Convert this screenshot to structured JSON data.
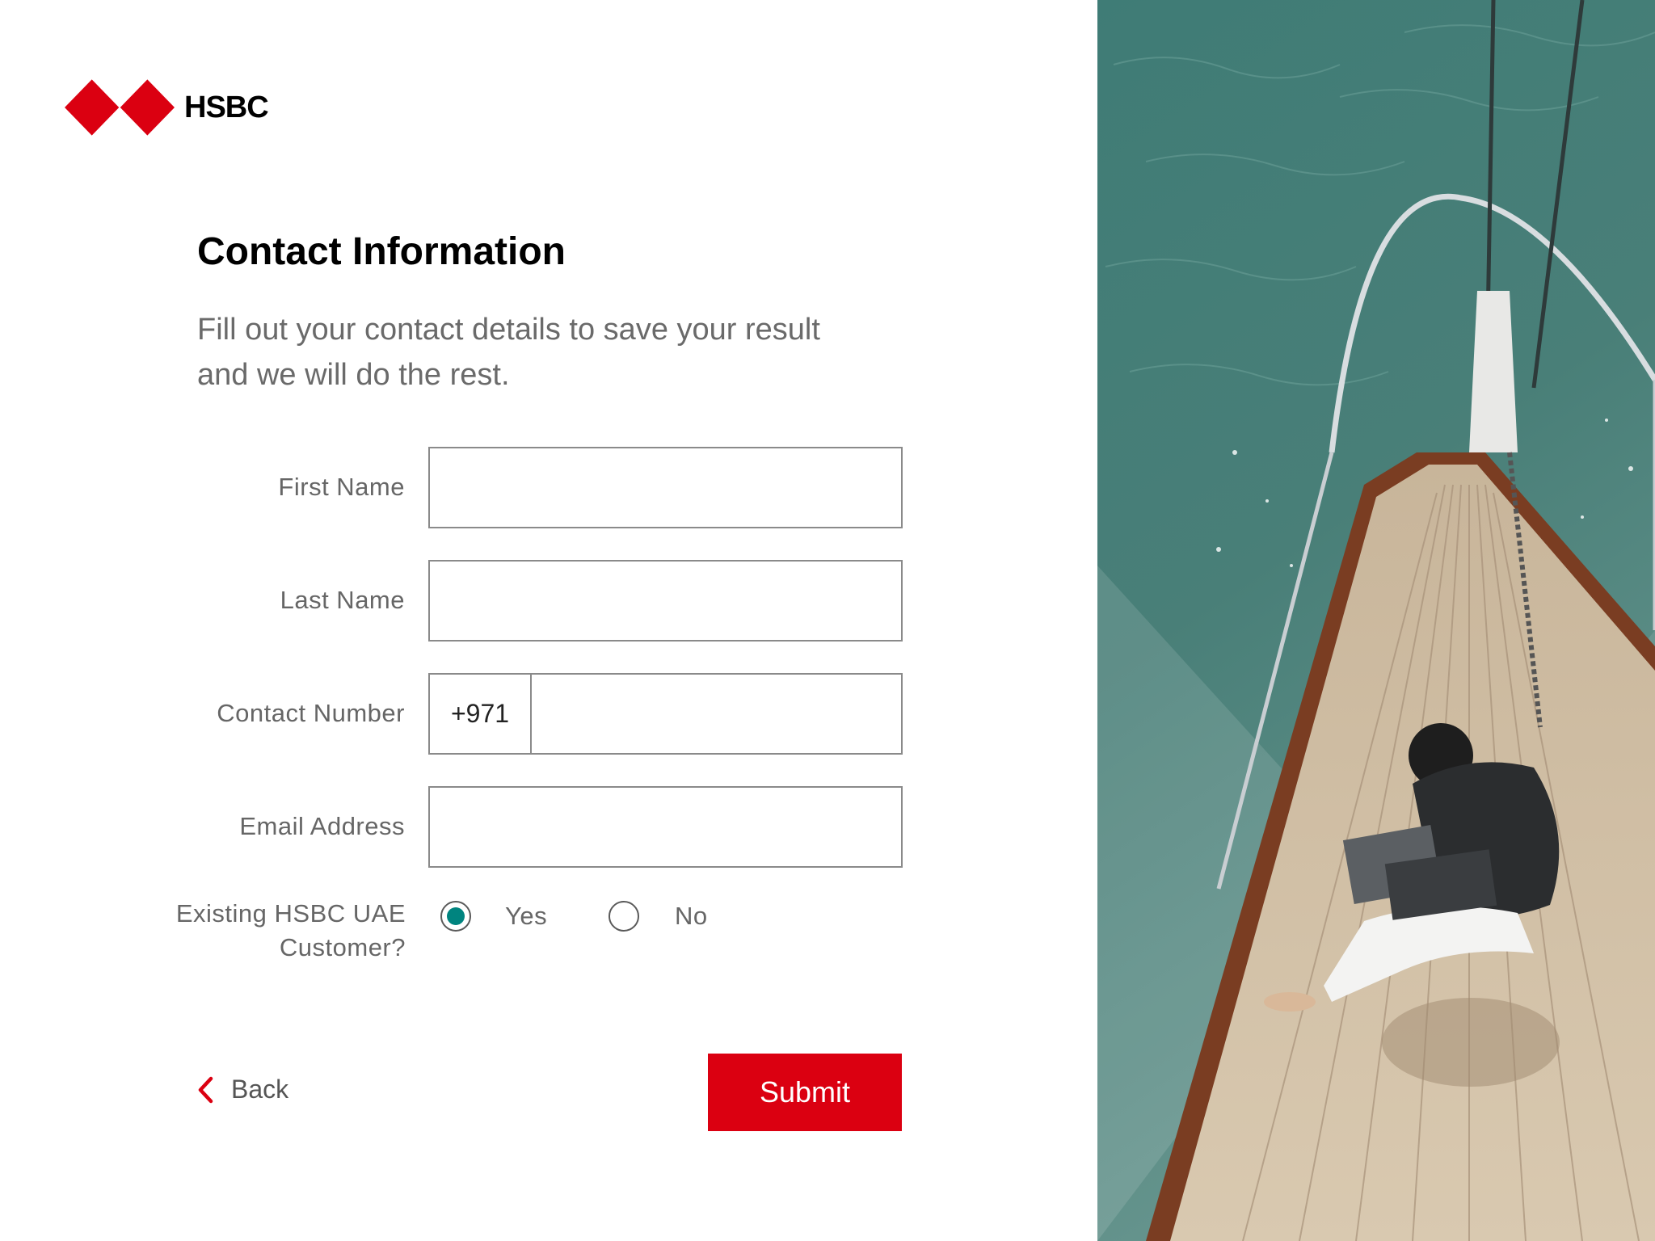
{
  "brand": {
    "name": "HSBC",
    "accent_color": "#db0011",
    "radio_color": "#00847f"
  },
  "header": {
    "title": "Contact Information",
    "subtitle": "Fill out your contact details to save your result and we will do the rest."
  },
  "form": {
    "first_name": {
      "label": "First Name",
      "value": ""
    },
    "last_name": {
      "label": "Last Name",
      "value": ""
    },
    "contact_number": {
      "label": "Contact Number",
      "prefix": "+971",
      "value": ""
    },
    "email": {
      "label": "Email Address",
      "value": ""
    },
    "existing_customer": {
      "label": "Existing HSBC UAE Customer?",
      "options": [
        {
          "label": "Yes",
          "selected": true
        },
        {
          "label": "No",
          "selected": false
        }
      ]
    }
  },
  "actions": {
    "back_label": "Back",
    "submit_label": "Submit"
  }
}
